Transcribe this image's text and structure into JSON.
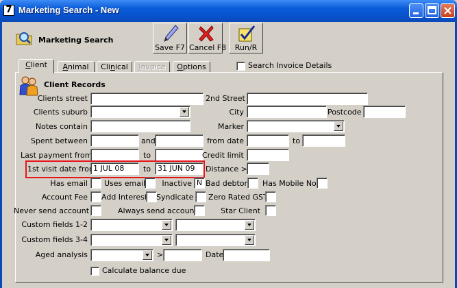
{
  "window": {
    "title": "Marketing Search - New",
    "app_icon_glyph": "7"
  },
  "toolbar": {
    "section_label": "Marketing Search",
    "save_label": "Save F7",
    "cancel_label": "Cancel F8",
    "run_label": "Run/R"
  },
  "tabs": [
    {
      "label": "Client",
      "accel": "C",
      "rest": "lient",
      "state": "active"
    },
    {
      "label": "Animal",
      "accel": "A",
      "rest": "nimal",
      "state": "normal"
    },
    {
      "label": "Clinical",
      "prefix": "Cli",
      "accel": "n",
      "rest": "ical",
      "state": "normal"
    },
    {
      "label": "Invoice",
      "accel": "I",
      "rest": "nvoice",
      "state": "disabled"
    },
    {
      "label": "Options",
      "accel": "O",
      "rest": "ptions",
      "state": "normal"
    }
  ],
  "search_invoice_details_label": "Search Invoice Details",
  "form": {
    "heading": "Client Records",
    "clients_street": "Clients street",
    "second_street": "2nd Street",
    "clients_suburb": "Clients suburb",
    "city": "City",
    "postcode": "Postcode",
    "notes_contain": "Notes contain",
    "marker": "Marker",
    "spent_between": "Spent between",
    "and": "and",
    "from_date": "from date",
    "to": "to",
    "last_payment_from": "Last payment from",
    "credit_limit": "Credit limit >",
    "first_visit_from": "1st visit date from",
    "first_visit_from_value": "1 JUL 08",
    "first_visit_to_value": "31 JUN 09",
    "distance": "Distance >",
    "has_email": "Has email",
    "uses_email": "Uses email",
    "inactive": "Inactive",
    "inactive_value": "N",
    "bad_debtor": "Bad debtor",
    "has_mobile_no": "Has Mobile No",
    "account_fee": "Account Fee",
    "add_interest": "Add Interest",
    "syndicate": "Syndicate",
    "zero_rated_gst": "Zero Rated GST",
    "never_send_account": "Never send account",
    "always_send_account": "Always send account",
    "star_client": "Star Client",
    "custom_fields_1_2": "Custom fields 1-2",
    "custom_fields_3_4": "Custom fields 3-4",
    "aged_analysis": "Aged analysis",
    "gt": ">",
    "date": "Date",
    "calculate_balance_due": "Calculate balance due"
  },
  "colors": {
    "title_bar": "#0a5ad8",
    "highlight_box": "#e8141c",
    "dialog_bg": "#d4d0c8"
  },
  "icons": [
    "app-icon",
    "minimize-icon",
    "maximize-icon",
    "close-icon",
    "magnifier-folder-icon",
    "pen-icon",
    "red-x-icon",
    "checkmark-icon",
    "people-icon"
  ]
}
